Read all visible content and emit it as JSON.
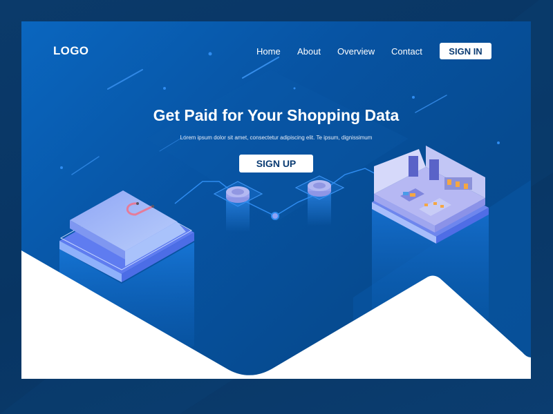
{
  "header": {
    "logo": "LOGO",
    "nav": [
      {
        "label": "Home"
      },
      {
        "label": "About"
      },
      {
        "label": "Overview"
      },
      {
        "label": "Contact"
      }
    ],
    "sign_in_label": "SIGN IN"
  },
  "hero": {
    "title": "Get Paid for Your Shopping Data",
    "subtitle": "Lorem ipsum dolor sit amet, consectetur adipiscing elit. Te ipsum, dignissimum",
    "sign_up_label": "SIGN UP"
  },
  "illustration": {
    "left_item": "shopping-bag",
    "middle_items": [
      "coin",
      "coin"
    ],
    "right_item": "isometric-store"
  },
  "colors": {
    "outer_background": "#0a3a6b",
    "card_blue": "#0753a2",
    "button_bg": "#ffffff",
    "button_text": "#0b3c73",
    "accent_line": "#2f8cf0",
    "white_wave": "#ffffff"
  }
}
